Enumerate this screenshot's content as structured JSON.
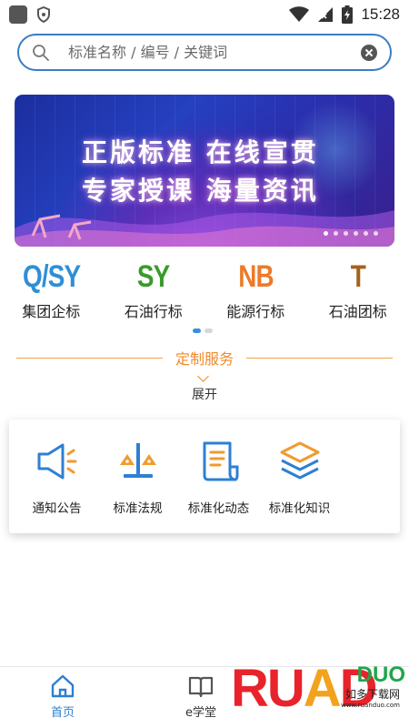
{
  "status_bar": {
    "time": "15:28"
  },
  "search": {
    "placeholder": "标准名称 / 编号 / 关键词"
  },
  "banner": {
    "line1": "正版标准  在线宣贯",
    "line2": "专家授课  海量资讯",
    "slide_count": 6,
    "active_slide": 1
  },
  "categories": [
    {
      "code": "Q/SY",
      "label": "集团企标",
      "color": "#2e8fd6"
    },
    {
      "code": "SY",
      "label": "石油行标",
      "color": "#3a9a2c"
    },
    {
      "code": "NB",
      "label": "能源行标",
      "color": "#ec7a2a"
    },
    {
      "code": "T",
      "label": "石油团标",
      "color": "#a4621c"
    }
  ],
  "category_pager": {
    "pages": 2,
    "active": 1
  },
  "service": {
    "title": "定制服务",
    "expand": "展开"
  },
  "features": [
    {
      "label": "通知公告",
      "icon": "megaphone-icon"
    },
    {
      "label": "标准法规",
      "icon": "scales-icon"
    },
    {
      "label": "标准化动态",
      "icon": "document-icon"
    },
    {
      "label": "标准化知识",
      "icon": "layers-icon"
    }
  ],
  "bottom_nav": {
    "home": "首页",
    "study": "e学堂",
    "active_color": "#2e7fd0"
  },
  "watermark": {
    "brand": "RUANDUO",
    "cn": "如多下载网",
    "url": "www.ruanduo.com"
  }
}
